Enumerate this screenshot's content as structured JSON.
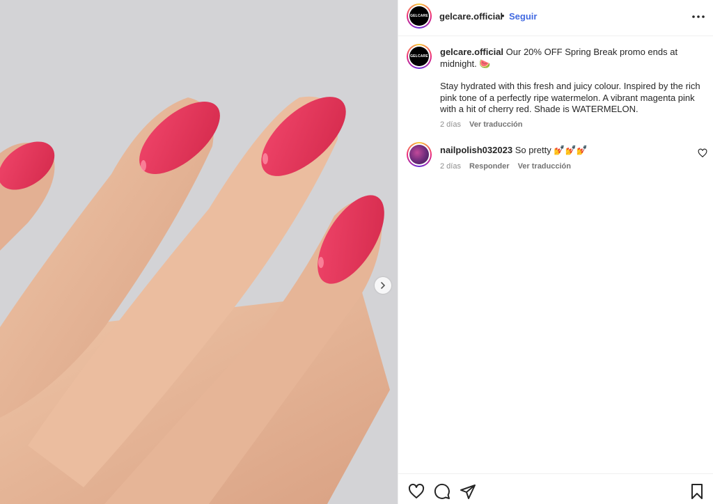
{
  "post": {
    "username": "gelcare.official",
    "avatar_logo_text": "GELCARE",
    "separator": "•",
    "follow_label": "Seguir",
    "more_icon": "more-horizontal-icon"
  },
  "caption": {
    "username": "gelcare.official",
    "line1": "Our 20% OFF Spring Break promo ends at midnight.",
    "emoji": "🍉",
    "paragraph2": "Stay hydrated with this fresh and juicy colour. Inspired by the rich pink tone of a perfectly ripe watermelon. A vibrant magenta pink with a hit of cherry red. Shade is WATERMELON.",
    "time": "2 días",
    "translate_label": "Ver traducción"
  },
  "comments": [
    {
      "username": "nailpolish032023",
      "text": "So pretty",
      "emojis": "💅💅💅",
      "time": "2 días",
      "reply_label": "Responder",
      "translate_label": "Ver traducción"
    }
  ],
  "actions": {
    "like_icon": "heart-icon",
    "comment_icon": "comment-icon",
    "share_icon": "share-icon",
    "save_icon": "bookmark-icon"
  },
  "colors": {
    "nail": "#e8375a",
    "skin": "#e8b99a",
    "background": "#d2d2d4",
    "link_blue": "#4169e1"
  }
}
